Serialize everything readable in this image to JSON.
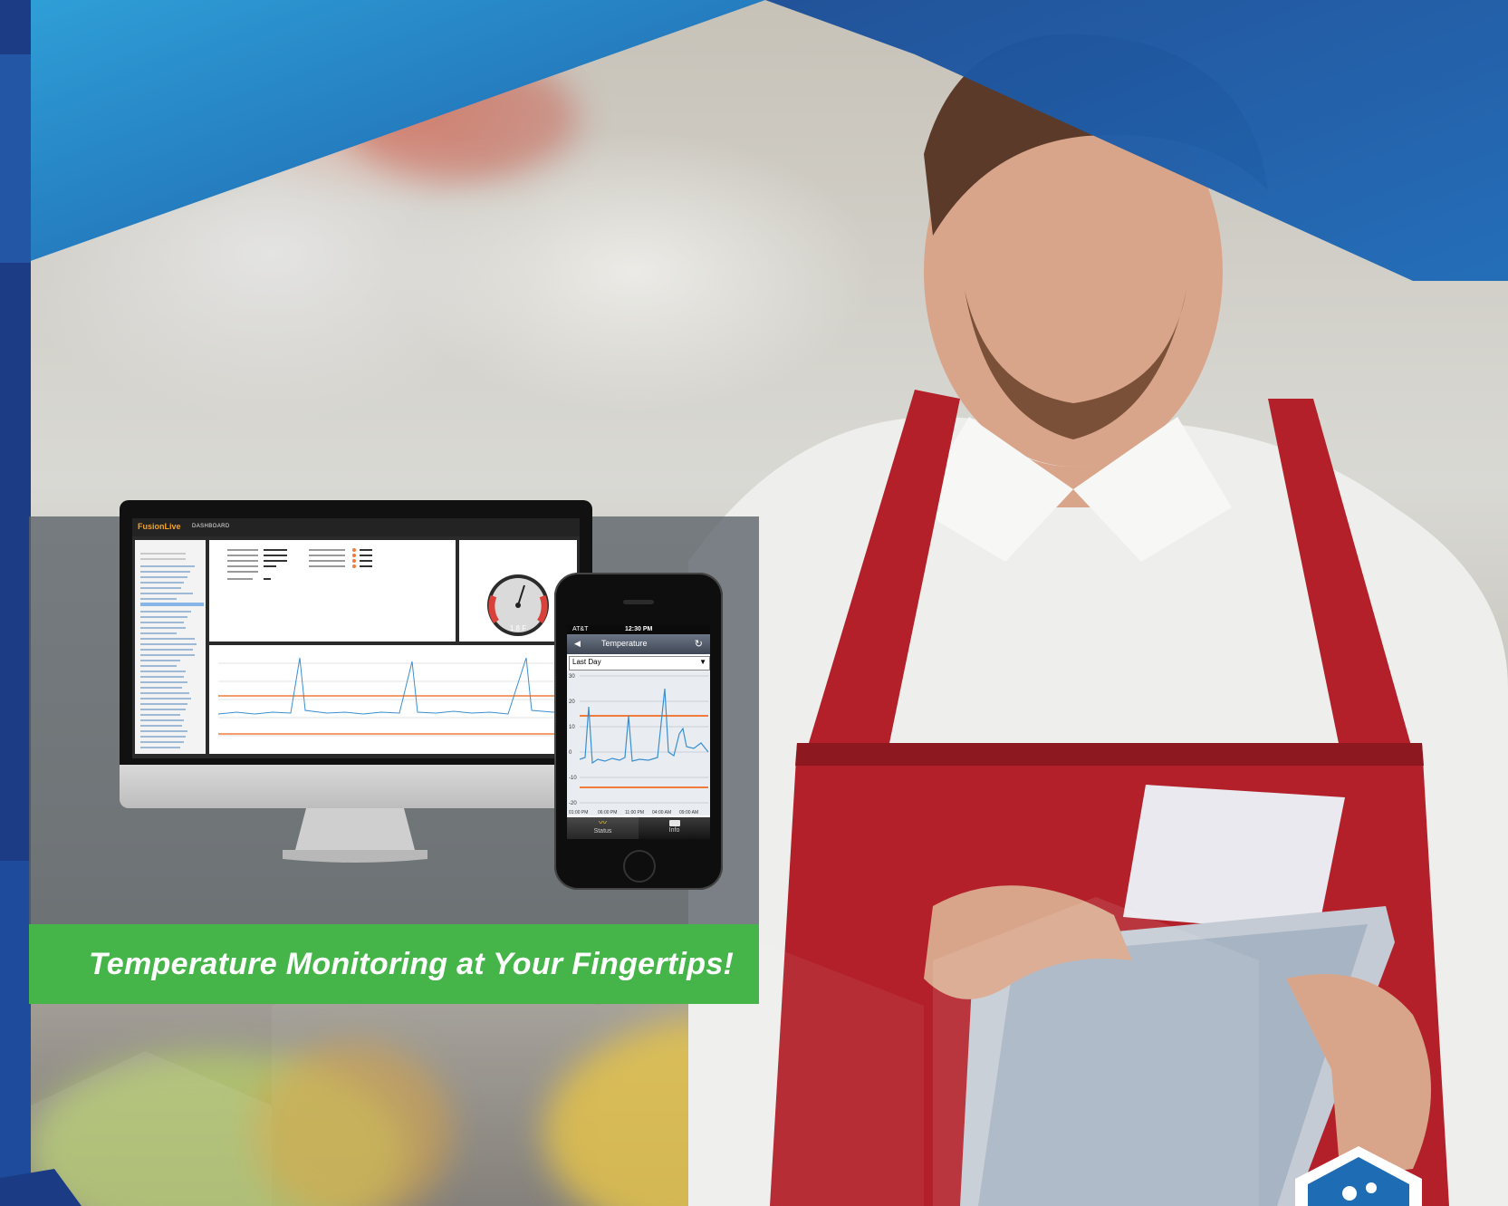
{
  "banner": {
    "text": "Temperature Monitoring at Your Fingertips!"
  },
  "dashboard": {
    "logo_text": "FusionLive",
    "title_text": "DASHBOARD",
    "gauge_reading": "1.8 F"
  },
  "phone": {
    "carrier": "AT&T",
    "time": "12:30 PM",
    "nav_title": "Temperature",
    "range_selected": "Last Day",
    "y_ticks": [
      "30",
      "20",
      "10",
      "0",
      "-10",
      "-20"
    ],
    "x_ticks": [
      "01:00 PM",
      "06:00 PM",
      "11:00 PM",
      "04:00 AM",
      "09:00 AM"
    ],
    "tabs": [
      {
        "label": "Status"
      },
      {
        "label": "Info"
      }
    ]
  },
  "colors": {
    "banner_green": "#46b549",
    "brand_blue": "#1e4f9c",
    "apron_red": "#b3202a",
    "threshold_orange": "#f07b3a",
    "trace_blue": "#3a8fd0"
  },
  "icons": {
    "back": "back-arrow-icon",
    "refresh": "refresh-icon",
    "status_tab": "chart-icon",
    "info_tab": "card-icon",
    "corner_logo": "hexagon-logo-icon"
  }
}
